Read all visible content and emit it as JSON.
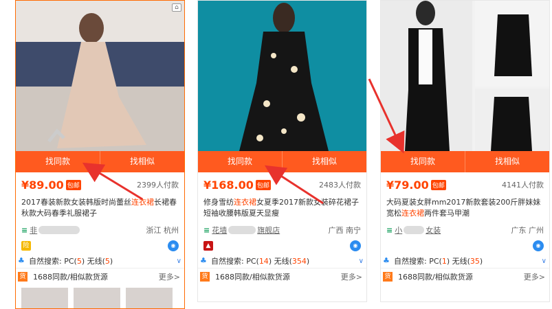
{
  "cards": [
    {
      "find_same_label": "找同款",
      "find_similar_label": "找相似",
      "price": "¥89.00",
      "badge": "包邮",
      "sales": "2399人付款",
      "title_pre": "2017春装新款女装韩版时尚蕾丝",
      "title_kw": "连衣裙",
      "title_post": "长裙春秋款大码春季礼服裙子",
      "shop": "非",
      "location": "浙江 杭州",
      "tag_icon": "险",
      "search_label": "自然搜索: PC(",
      "search_pc": "5",
      "search_mid": ") 无线(",
      "search_wx": "5",
      "search_end": ")",
      "source_label": "1688同款/相似款货源",
      "more_label": "更多>"
    },
    {
      "find_same_label": "找同款",
      "find_similar_label": "找相似",
      "price": "¥168.00",
      "badge": "包邮",
      "sales": "2483人付款",
      "title_pre": "修身雪纺",
      "title_kw": "连衣裙",
      "title_post": "女夏季2017新款女装碎花裙子短袖收腰韩版夏天显瘦",
      "shop": "花墙",
      "shop_tail": "旗舰店",
      "location": "广西 南宁",
      "search_label": "自然搜索: PC(",
      "search_pc": "14",
      "search_mid": ") 无线(",
      "search_wx": "354",
      "search_end": ")",
      "source_label": "1688同款/相似款货源",
      "more_label": "更多>"
    },
    {
      "find_same_label": "找同款",
      "find_similar_label": "找相似",
      "price": "¥79.00",
      "badge": "包邮",
      "sales": "4141人付款",
      "title_pre": "大码夏装女胖mm2017新款套装200斤胖妹妹宽松",
      "title_kw": "连衣裙",
      "title_post": "两件套马甲潮",
      "shop": "小",
      "shop_tail": "女装",
      "location": "广东 广州",
      "search_label": "自然搜索: PC(",
      "search_pc": "1",
      "search_mid": ") 无线(",
      "search_wx": "35",
      "search_end": ")",
      "source_label": "1688同款/相似款货源",
      "more_label": "更多>"
    }
  ],
  "colors": {
    "accent": "#ff5a1f",
    "price": "#ff4400",
    "link": "#3a80e6",
    "arrow": "#e8322d"
  },
  "icons": {
    "ww": "wangwang-icon",
    "bird": "search-bird-icon",
    "huo": "货"
  }
}
